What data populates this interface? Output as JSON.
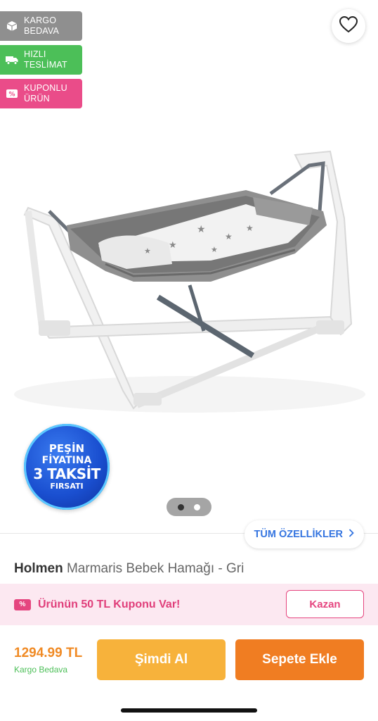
{
  "badges": [
    {
      "label_line1": "KARGO",
      "label_line2": "BEDAVA",
      "icon": "box-icon",
      "color": "#8f8f8f"
    },
    {
      "label_line1": "HIZLI",
      "label_line2": "TESLİMAT",
      "icon": "truck-icon",
      "color": "#4cbf58"
    },
    {
      "label_line1": "KUPONLU",
      "label_line2": "ÜRÜN",
      "icon": "coupon-icon",
      "color": "#ea4c89"
    }
  ],
  "favorite_icon": "heart-icon",
  "promo_sticker": {
    "line1": "PEŞİN",
    "line2": "FİYATINA",
    "line3": "3 TAKSİT",
    "line4": "FIRSATI"
  },
  "carousel": {
    "total": 2,
    "active_index": 0
  },
  "all_features_label": "TÜM ÖZELLİKLER",
  "product": {
    "brand": "Holmen",
    "name": "Marmaris Bebek Hamağı - Gri"
  },
  "coupon": {
    "icon_text": "%",
    "text": "Ürünün 50 TL Kuponu Var!",
    "button_label": "Kazan"
  },
  "purchase": {
    "price": "1294.99 TL",
    "shipping_note": "Kargo Bedava",
    "buy_now_label": "Şimdi Al",
    "add_to_cart_label": "Sepete Ekle"
  },
  "colors": {
    "accent_blue": "#3575e0",
    "coupon_pink": "#e5457f",
    "price_orange": "#f08a24",
    "buy_yellow": "#f7b23b",
    "cart_orange": "#f07d22",
    "shipping_green": "#4cbf58"
  }
}
